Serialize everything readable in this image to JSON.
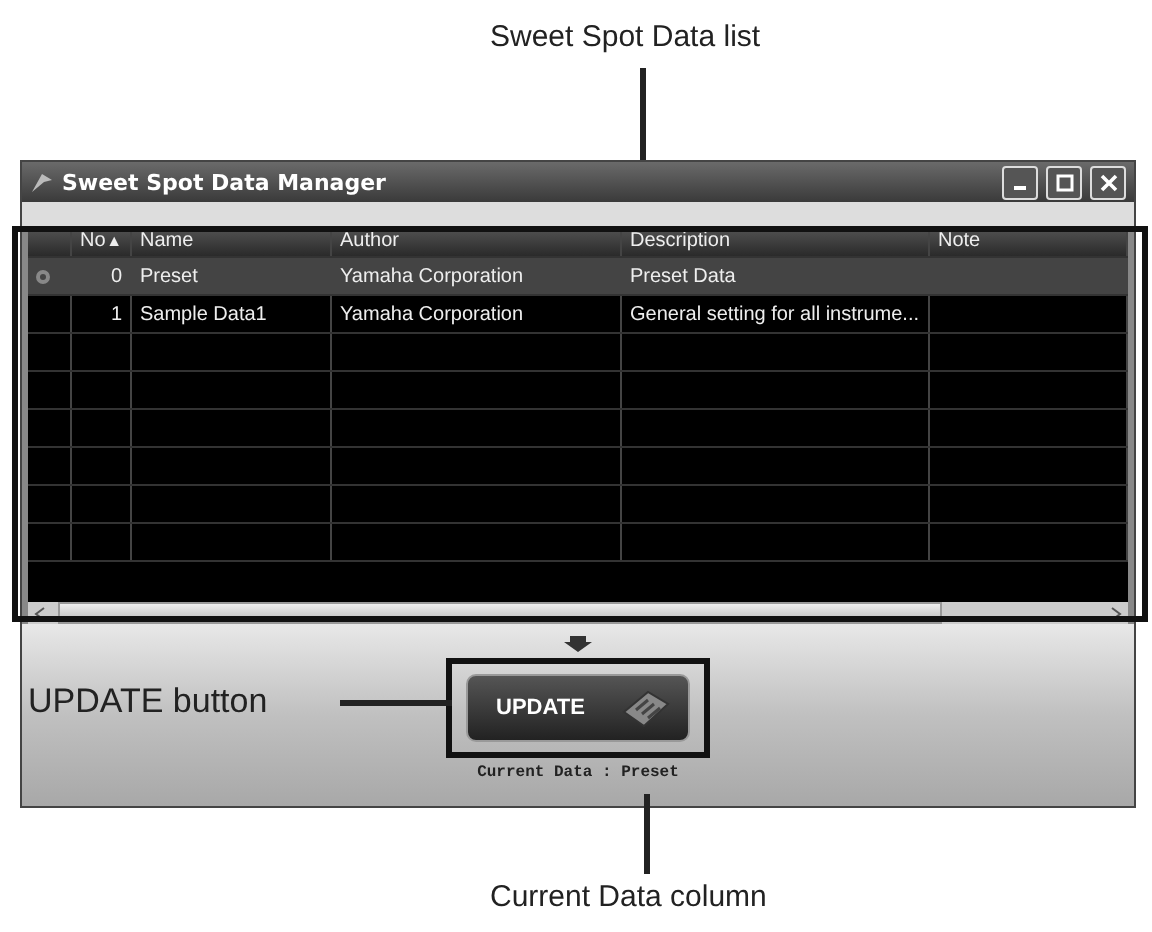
{
  "callouts": {
    "list": "Sweet Spot Data list",
    "button": "UPDATE button",
    "current": "Current Data column"
  },
  "window": {
    "title": "Sweet Spot Data Manager"
  },
  "table": {
    "columns": [
      {
        "label": "No",
        "sort_indicator": "▲"
      },
      {
        "label": "Name"
      },
      {
        "label": "Author"
      },
      {
        "label": "Description"
      },
      {
        "label": "Note"
      }
    ],
    "rows": [
      {
        "current": true,
        "selected": true,
        "no": "0",
        "name": "Preset",
        "author": "Yamaha Corporation",
        "description": "Preset Data"
      },
      {
        "current": false,
        "selected": false,
        "no": "1",
        "name": "Sample Data1",
        "author": "Yamaha Corporation",
        "description": "General setting for all instrume..."
      }
    ]
  },
  "update_button": {
    "label": "UPDATE"
  },
  "current_data": "Current Data : Preset"
}
